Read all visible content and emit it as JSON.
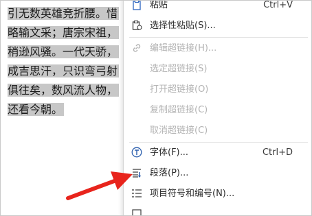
{
  "document": {
    "lines": [
      "引无数英雄竞折腰。惜",
      "略输文采；唐宗宋祖，",
      "稍逊风骚。一代天骄，",
      "成吉思汗，只识弯弓射",
      "俱往矣，数风流人物，",
      "还看今朝。"
    ]
  },
  "context_menu": {
    "items": [
      {
        "label": "粘贴",
        "shortcut": "Ctrl+V",
        "icon": "paste-icon",
        "enabled": true
      },
      {
        "label": "选择性粘贴(S)...",
        "shortcut": "",
        "icon": "paste-special-icon",
        "enabled": true
      },
      {
        "label": "编辑超链接(H)...",
        "shortcut": "",
        "icon": "link-icon",
        "enabled": false
      },
      {
        "label": "选定超链接(S)",
        "shortcut": "",
        "icon": "",
        "enabled": false
      },
      {
        "label": "打开超链接(O)",
        "shortcut": "",
        "icon": "",
        "enabled": false
      },
      {
        "label": "复制超链接(C)",
        "shortcut": "",
        "icon": "",
        "enabled": false
      },
      {
        "label": "取消超链接(C)",
        "shortcut": "",
        "icon": "",
        "enabled": false
      },
      {
        "label": "字体(F)...",
        "shortcut": "Ctrl+D",
        "icon": "font-icon",
        "enabled": true
      },
      {
        "label": "段落(P)...",
        "shortcut": "",
        "icon": "paragraph-icon",
        "enabled": true
      },
      {
        "label": "项目符号和编号(N)...",
        "shortcut": "",
        "icon": "bullet-list-icon",
        "enabled": true
      }
    ]
  },
  "annotation": {
    "arrow_color": "#e8241c"
  }
}
